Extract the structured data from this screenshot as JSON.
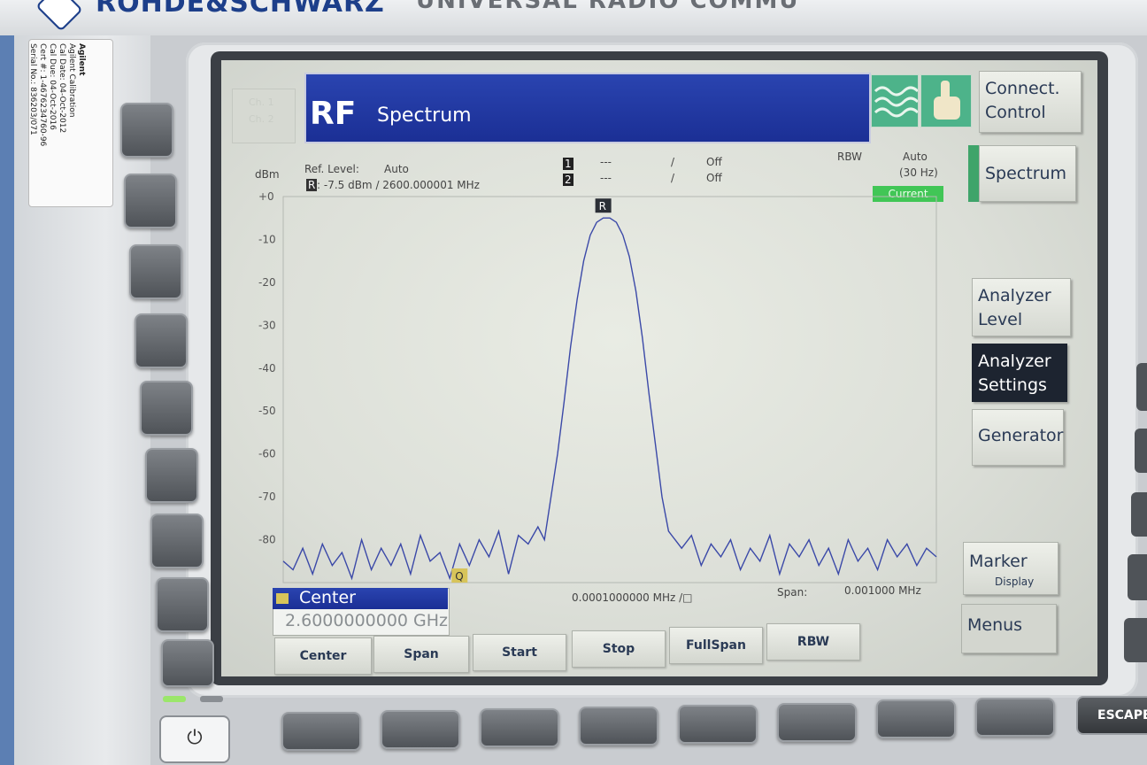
{
  "device": {
    "brand": "ROHDE&SCHWARZ",
    "model": "UNIVERSAL RADIO COMMU",
    "escape_label": "ESCAPE",
    "power_symbol": "⏻"
  },
  "calibration_sticker": {
    "vendor": "Agilent",
    "heading": "Agilent Calibration",
    "cal_date": "Cal Date: 04-Oct-2012",
    "cal_due": "Cal Due: 04-Oct-2016",
    "cert": "Cert #: 1-4676234760-96",
    "serial": "Serial No.: 836203/071"
  },
  "screen": {
    "channel_tabs": [
      "Ch. 1",
      "Ch. 2"
    ],
    "title_main": "RF",
    "title_sub": "Spectrum",
    "right_softkeys": {
      "connect": "Connect. Control",
      "spectrum": "Spectrum",
      "analyzer_level": "Analyzer Level",
      "analyzer_settings": "Analyzer Settings",
      "generator": "Generator",
      "marker": "Marker",
      "marker_sub": "Display",
      "menus": "Menus"
    },
    "header": {
      "unit": "dBm",
      "ref_level_label": "Ref. Level:",
      "ref_level_mode": "Auto",
      "ref_marker": "R",
      "ref_value": ": -7.5 dBm /  2600.000001  MHz",
      "marker1_id": "1",
      "marker1_val": "---",
      "marker1_sep": "/",
      "marker1_state": "Off",
      "marker2_id": "2",
      "marker2_val": "---",
      "marker2_sep": "/",
      "marker2_state": "Off",
      "rbw_label": "RBW",
      "rbw_mode": "Auto",
      "rbw_value": "(30 Hz)",
      "current_label": "Current"
    },
    "footer": {
      "center_label": "Center",
      "center_value": "2.6000000000 GHz",
      "step_value": "0.0001000000 MHz /□",
      "span_label": "Span:",
      "span_value": "0.001000  MHz",
      "marker_q": "Q",
      "marker_r": "R"
    },
    "bottom_softkeys": [
      "Center",
      "Span",
      "Start",
      "Stop",
      "FullSpan",
      "RBW"
    ]
  },
  "chart_data": {
    "type": "line",
    "ylabel": "dBm",
    "y_ticks": [
      "+0",
      "-10",
      "-20",
      "-30",
      "-40",
      "-50",
      "-60",
      "-70",
      "-80"
    ],
    "ylim": [
      -90,
      0
    ],
    "xlim": [
      -0.0005,
      0.0005
    ],
    "x_units": "MHz offset from 2600 MHz",
    "grid": false,
    "color": "#3b49a8",
    "series": [
      {
        "x": [
          -0.0005,
          -0.000485,
          -0.00047,
          -0.000455,
          -0.00044,
          -0.000425,
          -0.00041,
          -0.000395,
          -0.00038,
          -0.000365,
          -0.00035,
          -0.000335,
          -0.00032,
          -0.000305,
          -0.00029,
          -0.000275,
          -0.00026,
          -0.000245,
          -0.00023,
          -0.000215,
          -0.0002,
          -0.000185,
          -0.00017,
          -0.000155,
          -0.00014,
          -0.000125,
          -0.00011,
          -0.0001,
          -9e-05,
          -8e-05,
          -7e-05,
          -6e-05,
          -5e-05,
          -4e-05,
          -3e-05,
          -2e-05,
          -1e-05,
          0,
          1e-05,
          2e-05,
          3e-05,
          4e-05,
          5e-05,
          6e-05,
          7e-05,
          8e-05,
          9e-05,
          0.0001,
          0.00011,
          0.000125,
          0.00014,
          0.000155,
          0.00017,
          0.000185,
          0.0002,
          0.000215,
          0.00023,
          0.000245,
          0.00026,
          0.000275,
          0.00029,
          0.000305,
          0.00032,
          0.000335,
          0.00035,
          0.000365,
          0.00038,
          0.000395,
          0.00041,
          0.000425,
          0.00044,
          0.000455,
          0.00047,
          0.000485,
          0.0005
        ],
        "y": [
          -85,
          -87,
          -82,
          -88,
          -81,
          -86,
          -83,
          -89,
          -80,
          -87,
          -82,
          -86,
          -81,
          -88,
          -79,
          -85,
          -83,
          -89,
          -81,
          -86,
          -80,
          -84,
          -78,
          -88,
          -79,
          -81,
          -77,
          -80,
          -70,
          -60,
          -48,
          -35,
          -24,
          -15,
          -9,
          -6,
          -5,
          -5,
          -6,
          -9,
          -14,
          -22,
          -33,
          -46,
          -58,
          -70,
          -78,
          -80,
          -82,
          -79,
          -86,
          -81,
          -84,
          -80,
          -87,
          -82,
          -85,
          -79,
          -88,
          -81,
          -84,
          -80,
          -86,
          -82,
          -88,
          -80,
          -85,
          -82,
          -87,
          -80,
          -84,
          -81,
          -86,
          -82,
          -84
        ]
      }
    ]
  }
}
